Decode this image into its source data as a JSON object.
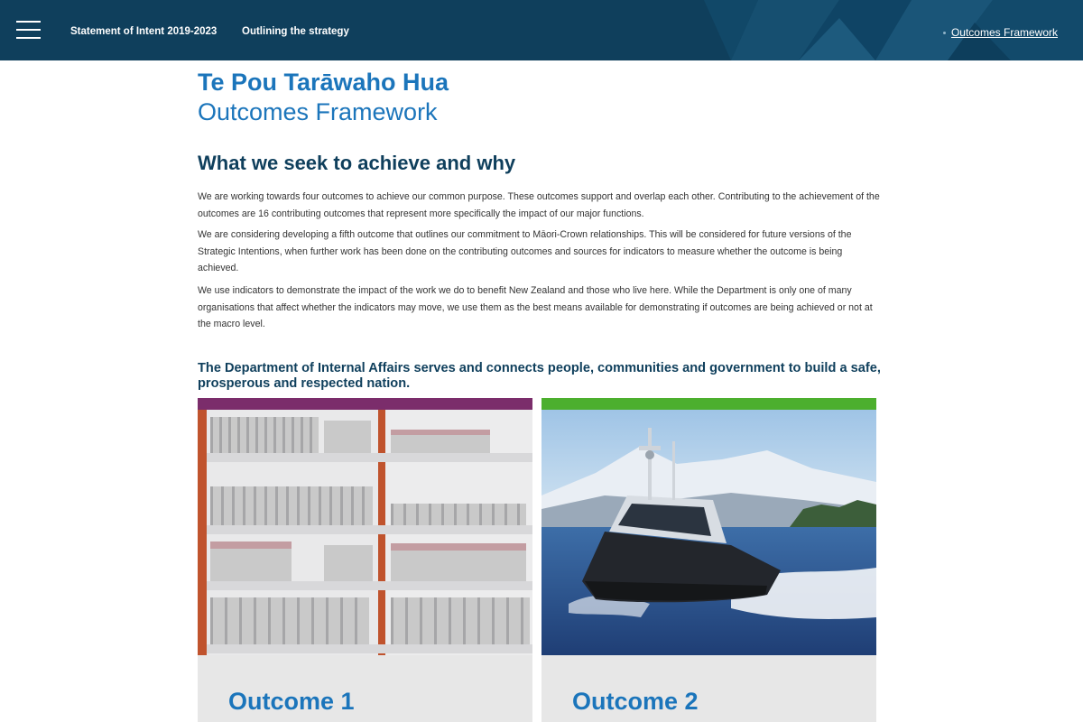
{
  "header": {
    "breadcrumbs": [
      "Statement of Intent 2019-2023",
      "Outlining the strategy"
    ],
    "nav_link": "Outcomes Framework"
  },
  "page": {
    "title_maori": "Te Pou Tarāwaho Hua",
    "title_english": "Outcomes Framework",
    "section_heading": "What we seek to achieve and why",
    "paragraphs": [
      "We are working towards four outcomes to achieve our common purpose. These outcomes support and overlap each other. Contributing to the achievement of the outcomes are 16 contributing outcomes that represent more specifically the impact of our major functions.",
      "We are considering developing a fifth outcome that outlines our commitment to Māori-Crown relationships. This will be considered for future versions of the Strategic Intentions, when further work has been done on the contributing outcomes and sources for indicators to measure whether the outcome is being achieved.",
      "We use indicators to demonstrate the impact of the work we do to benefit New Zealand and those who live here. While the Department is only one of many organisations that affect whether the indicators may move, we use them as the best means available for demonstrating if outcomes are being achieved or not at the macro level."
    ],
    "lead_statement": "The Department of Internal Affairs serves and connects people, communities and government to build a safe, prosperous and respected nation."
  },
  "cards": [
    {
      "title": "Outcome 1",
      "accent": "#7b2d6b",
      "image": "library-bookshelves-photo"
    },
    {
      "title": "Outcome 2",
      "accent": "#4caf2e",
      "image": "patrol-boat-photo"
    }
  ],
  "colors": {
    "header_bg": "#0f3f5c",
    "title_blue": "#1b75bb",
    "heading_navy": "#0f3f5c",
    "card_bg": "#e7e7e7"
  }
}
